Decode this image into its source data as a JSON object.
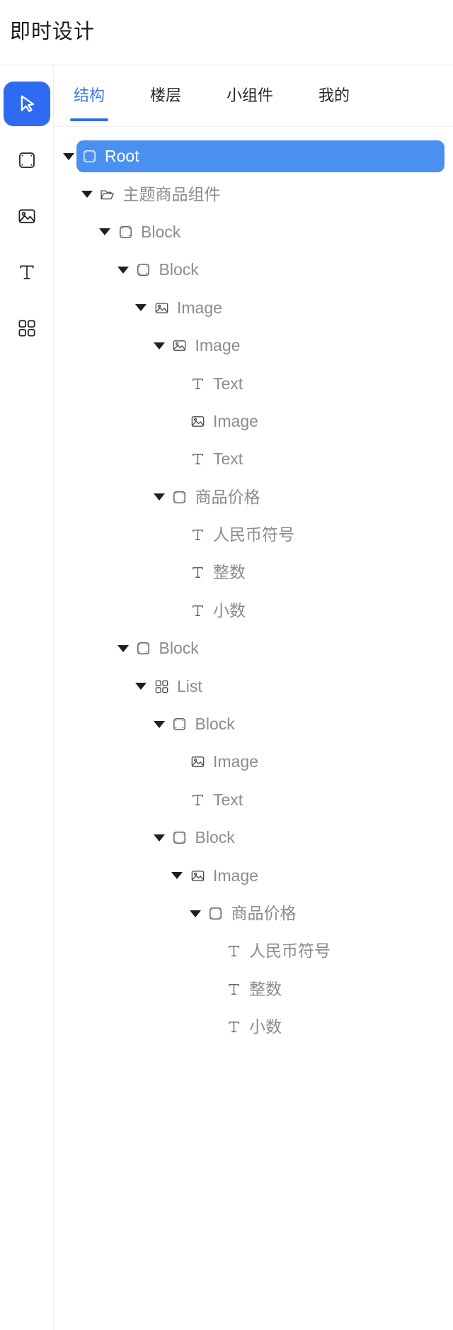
{
  "header": {
    "title": "即时设计"
  },
  "colors": {
    "accent": "#2f6bf2",
    "tab_active": "#3b7bf0",
    "row_selected_bg": "#4a90f0",
    "node_label": "#8c8c8c",
    "border": "#eeeeee"
  },
  "tool_rail": {
    "items": [
      {
        "icon": "cursor-icon",
        "name": "select-tool",
        "active": true
      },
      {
        "icon": "block-icon",
        "name": "block-tool",
        "active": false
      },
      {
        "icon": "image-icon",
        "name": "image-tool",
        "active": false
      },
      {
        "icon": "text-icon",
        "name": "text-tool",
        "active": false
      },
      {
        "icon": "grid-icon",
        "name": "list-tool",
        "active": false
      }
    ]
  },
  "tabs": [
    {
      "label": "结构",
      "active": true
    },
    {
      "label": "楼层",
      "active": false
    },
    {
      "label": "小组件",
      "active": false
    },
    {
      "label": "我的",
      "active": false
    }
  ],
  "tree": {
    "nodes": [
      {
        "label": "Root",
        "icon": "block-icon",
        "depth": 0,
        "expandable": true,
        "expanded": true,
        "selected": true
      },
      {
        "label": "主题商品组件",
        "icon": "folder-icon",
        "depth": 1,
        "expandable": true,
        "expanded": true,
        "selected": false
      },
      {
        "label": "Block",
        "icon": "block-icon",
        "depth": 2,
        "expandable": true,
        "expanded": true,
        "selected": false
      },
      {
        "label": "Block",
        "icon": "block-icon",
        "depth": 3,
        "expandable": true,
        "expanded": true,
        "selected": false
      },
      {
        "label": "Image",
        "icon": "image-icon",
        "depth": 4,
        "expandable": true,
        "expanded": true,
        "selected": false
      },
      {
        "label": "Image",
        "icon": "image-icon",
        "depth": 5,
        "expandable": true,
        "expanded": true,
        "selected": false
      },
      {
        "label": "Text",
        "icon": "text-icon",
        "depth": 6,
        "expandable": false,
        "expanded": false,
        "selected": false
      },
      {
        "label": "Image",
        "icon": "image-icon",
        "depth": 6,
        "expandable": false,
        "expanded": false,
        "selected": false
      },
      {
        "label": "Text",
        "icon": "text-icon",
        "depth": 6,
        "expandable": false,
        "expanded": false,
        "selected": false
      },
      {
        "label": "商品价格",
        "icon": "block-icon",
        "depth": 5,
        "expandable": true,
        "expanded": true,
        "selected": false
      },
      {
        "label": "人民币符号",
        "icon": "text-icon",
        "depth": 6,
        "expandable": false,
        "expanded": false,
        "selected": false
      },
      {
        "label": "整数",
        "icon": "text-icon",
        "depth": 6,
        "expandable": false,
        "expanded": false,
        "selected": false
      },
      {
        "label": "小数",
        "icon": "text-icon",
        "depth": 6,
        "expandable": false,
        "expanded": false,
        "selected": false
      },
      {
        "label": "Block",
        "icon": "block-icon",
        "depth": 3,
        "expandable": true,
        "expanded": true,
        "selected": false
      },
      {
        "label": "List",
        "icon": "grid-icon",
        "depth": 4,
        "expandable": true,
        "expanded": true,
        "selected": false
      },
      {
        "label": "Block",
        "icon": "block-icon",
        "depth": 5,
        "expandable": true,
        "expanded": true,
        "selected": false
      },
      {
        "label": "Image",
        "icon": "image-icon",
        "depth": 6,
        "expandable": false,
        "expanded": false,
        "selected": false
      },
      {
        "label": "Text",
        "icon": "text-icon",
        "depth": 6,
        "expandable": false,
        "expanded": false,
        "selected": false
      },
      {
        "label": "Block",
        "icon": "block-icon",
        "depth": 5,
        "expandable": true,
        "expanded": true,
        "selected": false
      },
      {
        "label": "Image",
        "icon": "image-icon",
        "depth": 6,
        "expandable": true,
        "expanded": true,
        "selected": false
      },
      {
        "label": "商品价格",
        "icon": "block-icon",
        "depth": 7,
        "expandable": true,
        "expanded": true,
        "selected": false
      },
      {
        "label": "人民币符号",
        "icon": "text-icon",
        "depth": 8,
        "expandable": false,
        "expanded": false,
        "selected": false
      },
      {
        "label": "整数",
        "icon": "text-icon",
        "depth": 8,
        "expandable": false,
        "expanded": false,
        "selected": false
      },
      {
        "label": "小数",
        "icon": "text-icon",
        "depth": 8,
        "expandable": false,
        "expanded": false,
        "selected": false
      }
    ]
  }
}
